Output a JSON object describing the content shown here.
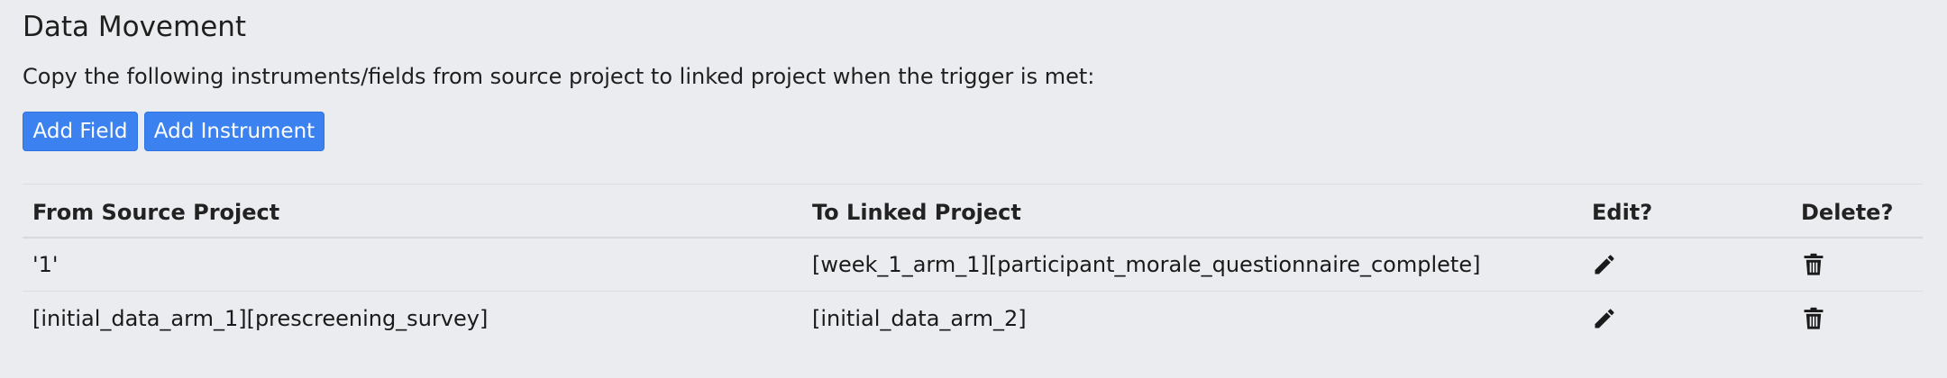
{
  "section": {
    "title": "Data Movement",
    "description": "Copy the following instruments/fields from source project to linked project when the trigger is met:"
  },
  "buttons": {
    "add_field": "Add Field",
    "add_instrument": "Add Instrument"
  },
  "table": {
    "headers": {
      "from": "From Source Project",
      "to": "To Linked Project",
      "edit": "Edit?",
      "delete": "Delete?"
    },
    "rows": [
      {
        "from": "'1'",
        "to": "[week_1_arm_1][participant_morale_questionnaire_complete]"
      },
      {
        "from": "[initial_data_arm_1][prescreening_survey]",
        "to": "[initial_data_arm_2]"
      }
    ]
  },
  "icons": {
    "edit": "pencil-icon",
    "delete": "trash-icon"
  },
  "colors": {
    "accent": "#3b82f0",
    "background": "#ebecf0"
  }
}
